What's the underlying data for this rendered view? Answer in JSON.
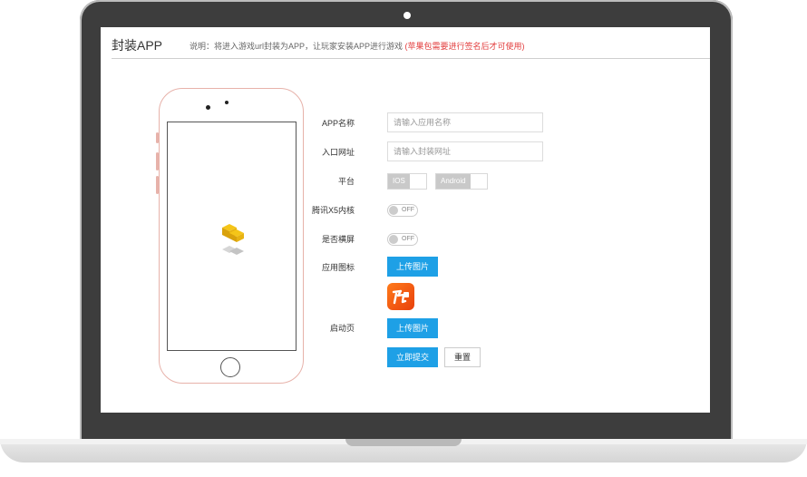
{
  "page": {
    "title": "封装APP",
    "description": "说明：将进入游戏url封装为APP，让玩家安装APP进行游戏",
    "warning": "(苹果包需要进行签名后才可使用)"
  },
  "form": {
    "app_name": {
      "label": "APP名称",
      "placeholder": "请输入应用名称",
      "value": ""
    },
    "entry_url": {
      "label": "入口网址",
      "placeholder": "请输入封装网址",
      "value": ""
    },
    "platform": {
      "label": "平台",
      "options": [
        "IOS",
        "Android"
      ]
    },
    "x5_core": {
      "label": "腾讯X5内核",
      "state": "OFF"
    },
    "landscape": {
      "label": "是否横屏",
      "state": "OFF"
    },
    "app_icon": {
      "label": "应用图标",
      "button": "上传图片",
      "icon_name": "orange-app-icon"
    },
    "splash": {
      "label": "启动页",
      "button": "上传图片"
    },
    "submit_label": "立即提交",
    "reset_label": "重置"
  },
  "colors": {
    "accent": "#1ea0e6",
    "warning": "#e23b3b",
    "lid": "#3d3d3d"
  }
}
